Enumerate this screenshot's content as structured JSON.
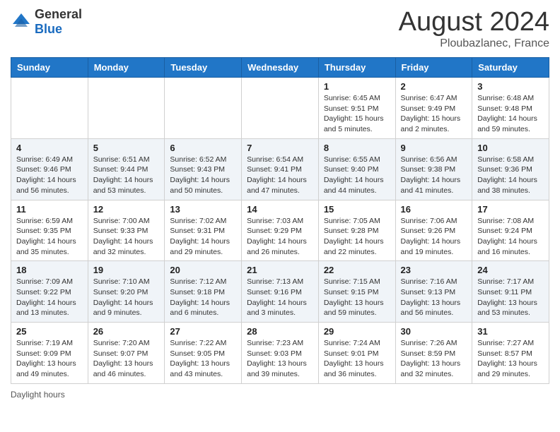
{
  "logo": {
    "general": "General",
    "blue": "Blue"
  },
  "header": {
    "month_year": "August 2024",
    "location": "Ploubazlanec, France"
  },
  "footer": {
    "label": "Daylight hours"
  },
  "weekdays": [
    "Sunday",
    "Monday",
    "Tuesday",
    "Wednesday",
    "Thursday",
    "Friday",
    "Saturday"
  ],
  "weeks": [
    [
      {
        "day": "",
        "info": ""
      },
      {
        "day": "",
        "info": ""
      },
      {
        "day": "",
        "info": ""
      },
      {
        "day": "",
        "info": ""
      },
      {
        "day": "1",
        "info": "Sunrise: 6:45 AM\nSunset: 9:51 PM\nDaylight: 15 hours\nand 5 minutes."
      },
      {
        "day": "2",
        "info": "Sunrise: 6:47 AM\nSunset: 9:49 PM\nDaylight: 15 hours\nand 2 minutes."
      },
      {
        "day": "3",
        "info": "Sunrise: 6:48 AM\nSunset: 9:48 PM\nDaylight: 14 hours\nand 59 minutes."
      }
    ],
    [
      {
        "day": "4",
        "info": "Sunrise: 6:49 AM\nSunset: 9:46 PM\nDaylight: 14 hours\nand 56 minutes."
      },
      {
        "day": "5",
        "info": "Sunrise: 6:51 AM\nSunset: 9:44 PM\nDaylight: 14 hours\nand 53 minutes."
      },
      {
        "day": "6",
        "info": "Sunrise: 6:52 AM\nSunset: 9:43 PM\nDaylight: 14 hours\nand 50 minutes."
      },
      {
        "day": "7",
        "info": "Sunrise: 6:54 AM\nSunset: 9:41 PM\nDaylight: 14 hours\nand 47 minutes."
      },
      {
        "day": "8",
        "info": "Sunrise: 6:55 AM\nSunset: 9:40 PM\nDaylight: 14 hours\nand 44 minutes."
      },
      {
        "day": "9",
        "info": "Sunrise: 6:56 AM\nSunset: 9:38 PM\nDaylight: 14 hours\nand 41 minutes."
      },
      {
        "day": "10",
        "info": "Sunrise: 6:58 AM\nSunset: 9:36 PM\nDaylight: 14 hours\nand 38 minutes."
      }
    ],
    [
      {
        "day": "11",
        "info": "Sunrise: 6:59 AM\nSunset: 9:35 PM\nDaylight: 14 hours\nand 35 minutes."
      },
      {
        "day": "12",
        "info": "Sunrise: 7:00 AM\nSunset: 9:33 PM\nDaylight: 14 hours\nand 32 minutes."
      },
      {
        "day": "13",
        "info": "Sunrise: 7:02 AM\nSunset: 9:31 PM\nDaylight: 14 hours\nand 29 minutes."
      },
      {
        "day": "14",
        "info": "Sunrise: 7:03 AM\nSunset: 9:29 PM\nDaylight: 14 hours\nand 26 minutes."
      },
      {
        "day": "15",
        "info": "Sunrise: 7:05 AM\nSunset: 9:28 PM\nDaylight: 14 hours\nand 22 minutes."
      },
      {
        "day": "16",
        "info": "Sunrise: 7:06 AM\nSunset: 9:26 PM\nDaylight: 14 hours\nand 19 minutes."
      },
      {
        "day": "17",
        "info": "Sunrise: 7:08 AM\nSunset: 9:24 PM\nDaylight: 14 hours\nand 16 minutes."
      }
    ],
    [
      {
        "day": "18",
        "info": "Sunrise: 7:09 AM\nSunset: 9:22 PM\nDaylight: 14 hours\nand 13 minutes."
      },
      {
        "day": "19",
        "info": "Sunrise: 7:10 AM\nSunset: 9:20 PM\nDaylight: 14 hours\nand 9 minutes."
      },
      {
        "day": "20",
        "info": "Sunrise: 7:12 AM\nSunset: 9:18 PM\nDaylight: 14 hours\nand 6 minutes."
      },
      {
        "day": "21",
        "info": "Sunrise: 7:13 AM\nSunset: 9:16 PM\nDaylight: 14 hours\nand 3 minutes."
      },
      {
        "day": "22",
        "info": "Sunrise: 7:15 AM\nSunset: 9:15 PM\nDaylight: 13 hours\nand 59 minutes."
      },
      {
        "day": "23",
        "info": "Sunrise: 7:16 AM\nSunset: 9:13 PM\nDaylight: 13 hours\nand 56 minutes."
      },
      {
        "day": "24",
        "info": "Sunrise: 7:17 AM\nSunset: 9:11 PM\nDaylight: 13 hours\nand 53 minutes."
      }
    ],
    [
      {
        "day": "25",
        "info": "Sunrise: 7:19 AM\nSunset: 9:09 PM\nDaylight: 13 hours\nand 49 minutes."
      },
      {
        "day": "26",
        "info": "Sunrise: 7:20 AM\nSunset: 9:07 PM\nDaylight: 13 hours\nand 46 minutes."
      },
      {
        "day": "27",
        "info": "Sunrise: 7:22 AM\nSunset: 9:05 PM\nDaylight: 13 hours\nand 43 minutes."
      },
      {
        "day": "28",
        "info": "Sunrise: 7:23 AM\nSunset: 9:03 PM\nDaylight: 13 hours\nand 39 minutes."
      },
      {
        "day": "29",
        "info": "Sunrise: 7:24 AM\nSunset: 9:01 PM\nDaylight: 13 hours\nand 36 minutes."
      },
      {
        "day": "30",
        "info": "Sunrise: 7:26 AM\nSunset: 8:59 PM\nDaylight: 13 hours\nand 32 minutes."
      },
      {
        "day": "31",
        "info": "Sunrise: 7:27 AM\nSunset: 8:57 PM\nDaylight: 13 hours\nand 29 minutes."
      }
    ]
  ]
}
